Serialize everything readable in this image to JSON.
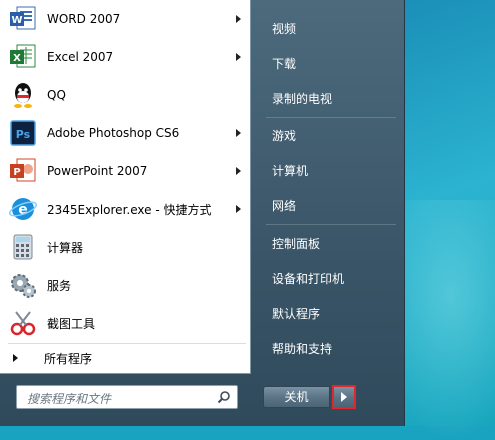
{
  "programs": [
    {
      "label": "WORD 2007",
      "icon": "word-icon",
      "has_submenu": true
    },
    {
      "label": "Excel 2007",
      "icon": "excel-icon",
      "has_submenu": true
    },
    {
      "label": "QQ",
      "icon": "qq-icon",
      "has_submenu": false
    },
    {
      "label": "Adobe Photoshop CS6",
      "icon": "photoshop-icon",
      "has_submenu": true
    },
    {
      "label": "PowerPoint 2007",
      "icon": "powerpoint-icon",
      "has_submenu": true
    },
    {
      "label": "2345Explorer.exe - 快捷方式",
      "icon": "browser-icon",
      "has_submenu": true
    },
    {
      "label": "计算器",
      "icon": "calculator-icon",
      "has_submenu": false
    },
    {
      "label": "服务",
      "icon": "services-gear-icon",
      "has_submenu": false
    },
    {
      "label": "截图工具",
      "icon": "snipping-tool-icon",
      "has_submenu": false
    }
  ],
  "all_programs_label": "所有程序",
  "search": {
    "placeholder": "搜索程序和文件"
  },
  "right_links": [
    {
      "label": "视频"
    },
    {
      "label": "下载"
    },
    {
      "label": "录制的电视"
    },
    {
      "label": "游戏"
    },
    {
      "label": "计算机"
    },
    {
      "label": "网络"
    },
    {
      "label": "控制面板"
    },
    {
      "label": "设备和打印机"
    },
    {
      "label": "默认程序"
    },
    {
      "label": "帮助和支持"
    }
  ],
  "shutdown": {
    "label": "关机"
  },
  "colors": {
    "highlight_border": "#e2262b",
    "menu_bg": "#3a5567"
  }
}
